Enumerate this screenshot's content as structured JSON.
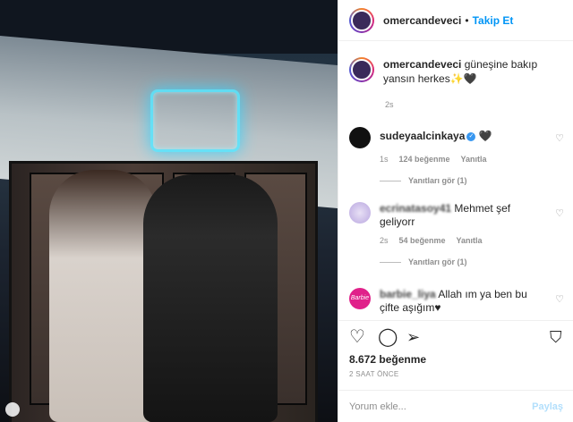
{
  "post": {
    "photo_alt": "",
    "header": {
      "username": "omercandeveci",
      "separator": "•",
      "follow_label": "Takip Et"
    },
    "caption": {
      "username": "omercandeveci",
      "text": "güneşine bakıp yansın herkes✨🖤",
      "time": "2s"
    },
    "comments": [
      {
        "username": "sudeyaalcinkaya",
        "verified": true,
        "text": "🖤",
        "time": "1s",
        "likes": "124 beğenme",
        "reply_label": "Yanıtla",
        "view_replies": "Yanıtları gör (1)"
      },
      {
        "username": "ecrinatasoy41",
        "text": "Mehmet şef geliyorr",
        "time": "2s",
        "likes": "54 beğenme",
        "reply_label": "Yanıtla",
        "view_replies": "Yanıtları gör (1)"
      },
      {
        "username": "barbie_liya",
        "text": "Allah ım ya ben bu çifte aşığım♥"
      }
    ],
    "like_count": "8.672 beğenme",
    "posted_ago": "2 SAAT ÖNCE",
    "comment_input_placeholder": "Yorum ekle...",
    "post_button_label": "Paylaş",
    "icons": {
      "like": "heart-icon",
      "comment": "comment-icon",
      "share": "paper-plane-icon",
      "save": "bookmark-icon",
      "comment_like": "small-heart-icon"
    },
    "colors": {
      "follow": "#0095f6",
      "verified": "#3897f0",
      "muted": "#8e8e8e"
    }
  }
}
